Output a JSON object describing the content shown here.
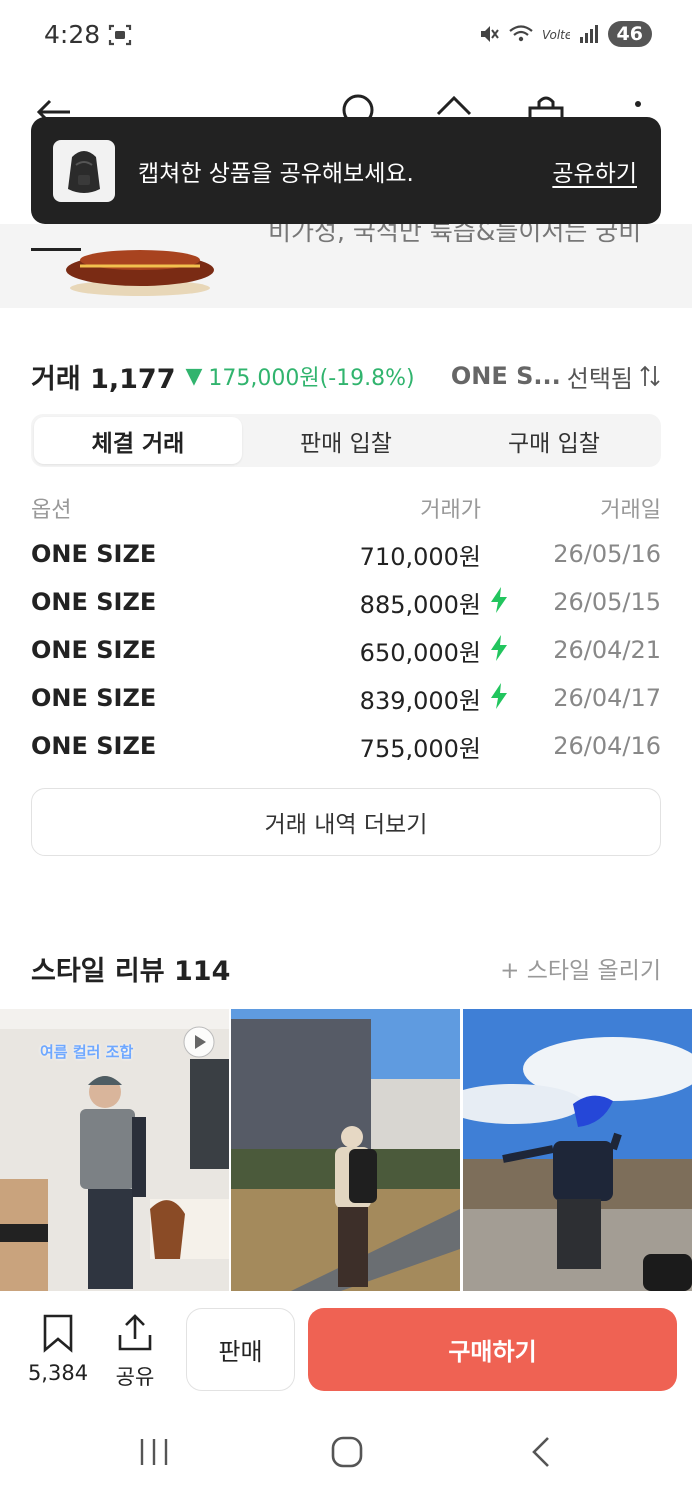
{
  "status_bar": {
    "time": "4:28",
    "battery": "46"
  },
  "toast": {
    "message": "캡쳐한 상품을 공유해보세요.",
    "link": "공유하기"
  },
  "banner": {
    "text": "비가성, 국석만 륙즙&들이서는 궁비"
  },
  "trade": {
    "title": "거래 1,177",
    "arrow": "▼",
    "change": "175,000원(-19.8%)",
    "select_value": "ONE S...",
    "select_suffix": "선택됨",
    "tabs": [
      {
        "label": "체결 거래",
        "active": true
      },
      {
        "label": "판매 입찰",
        "active": false
      },
      {
        "label": "구매 입찰",
        "active": false
      }
    ],
    "columns": {
      "option": "옵션",
      "price": "거래가",
      "date": "거래일"
    },
    "rows": [
      {
        "option": "ONE SIZE",
        "price": "710,000원",
        "fast": false,
        "date": "26/05/16"
      },
      {
        "option": "ONE SIZE",
        "price": "885,000원",
        "fast": true,
        "date": "26/05/15"
      },
      {
        "option": "ONE SIZE",
        "price": "650,000원",
        "fast": true,
        "date": "26/04/21"
      },
      {
        "option": "ONE SIZE",
        "price": "839,000원",
        "fast": true,
        "date": "26/04/17"
      },
      {
        "option": "ONE SIZE",
        "price": "755,000원",
        "fast": false,
        "date": "26/04/16"
      }
    ],
    "more_label": "거래 내역 더보기"
  },
  "style": {
    "title": "스타일 리뷰 114",
    "add_label": "+ 스타일 올리기",
    "photo1_caption": "여름 컬러 조합"
  },
  "action_bar": {
    "bookmark_count": "5,384",
    "share_label": "공유",
    "sell_label": "판매",
    "buy_label": "구매하기"
  },
  "colors": {
    "accent_green": "#31b46e",
    "buy_red": "#ef6253",
    "toast_bg": "#222222",
    "bolt_green": "#22c55e"
  }
}
